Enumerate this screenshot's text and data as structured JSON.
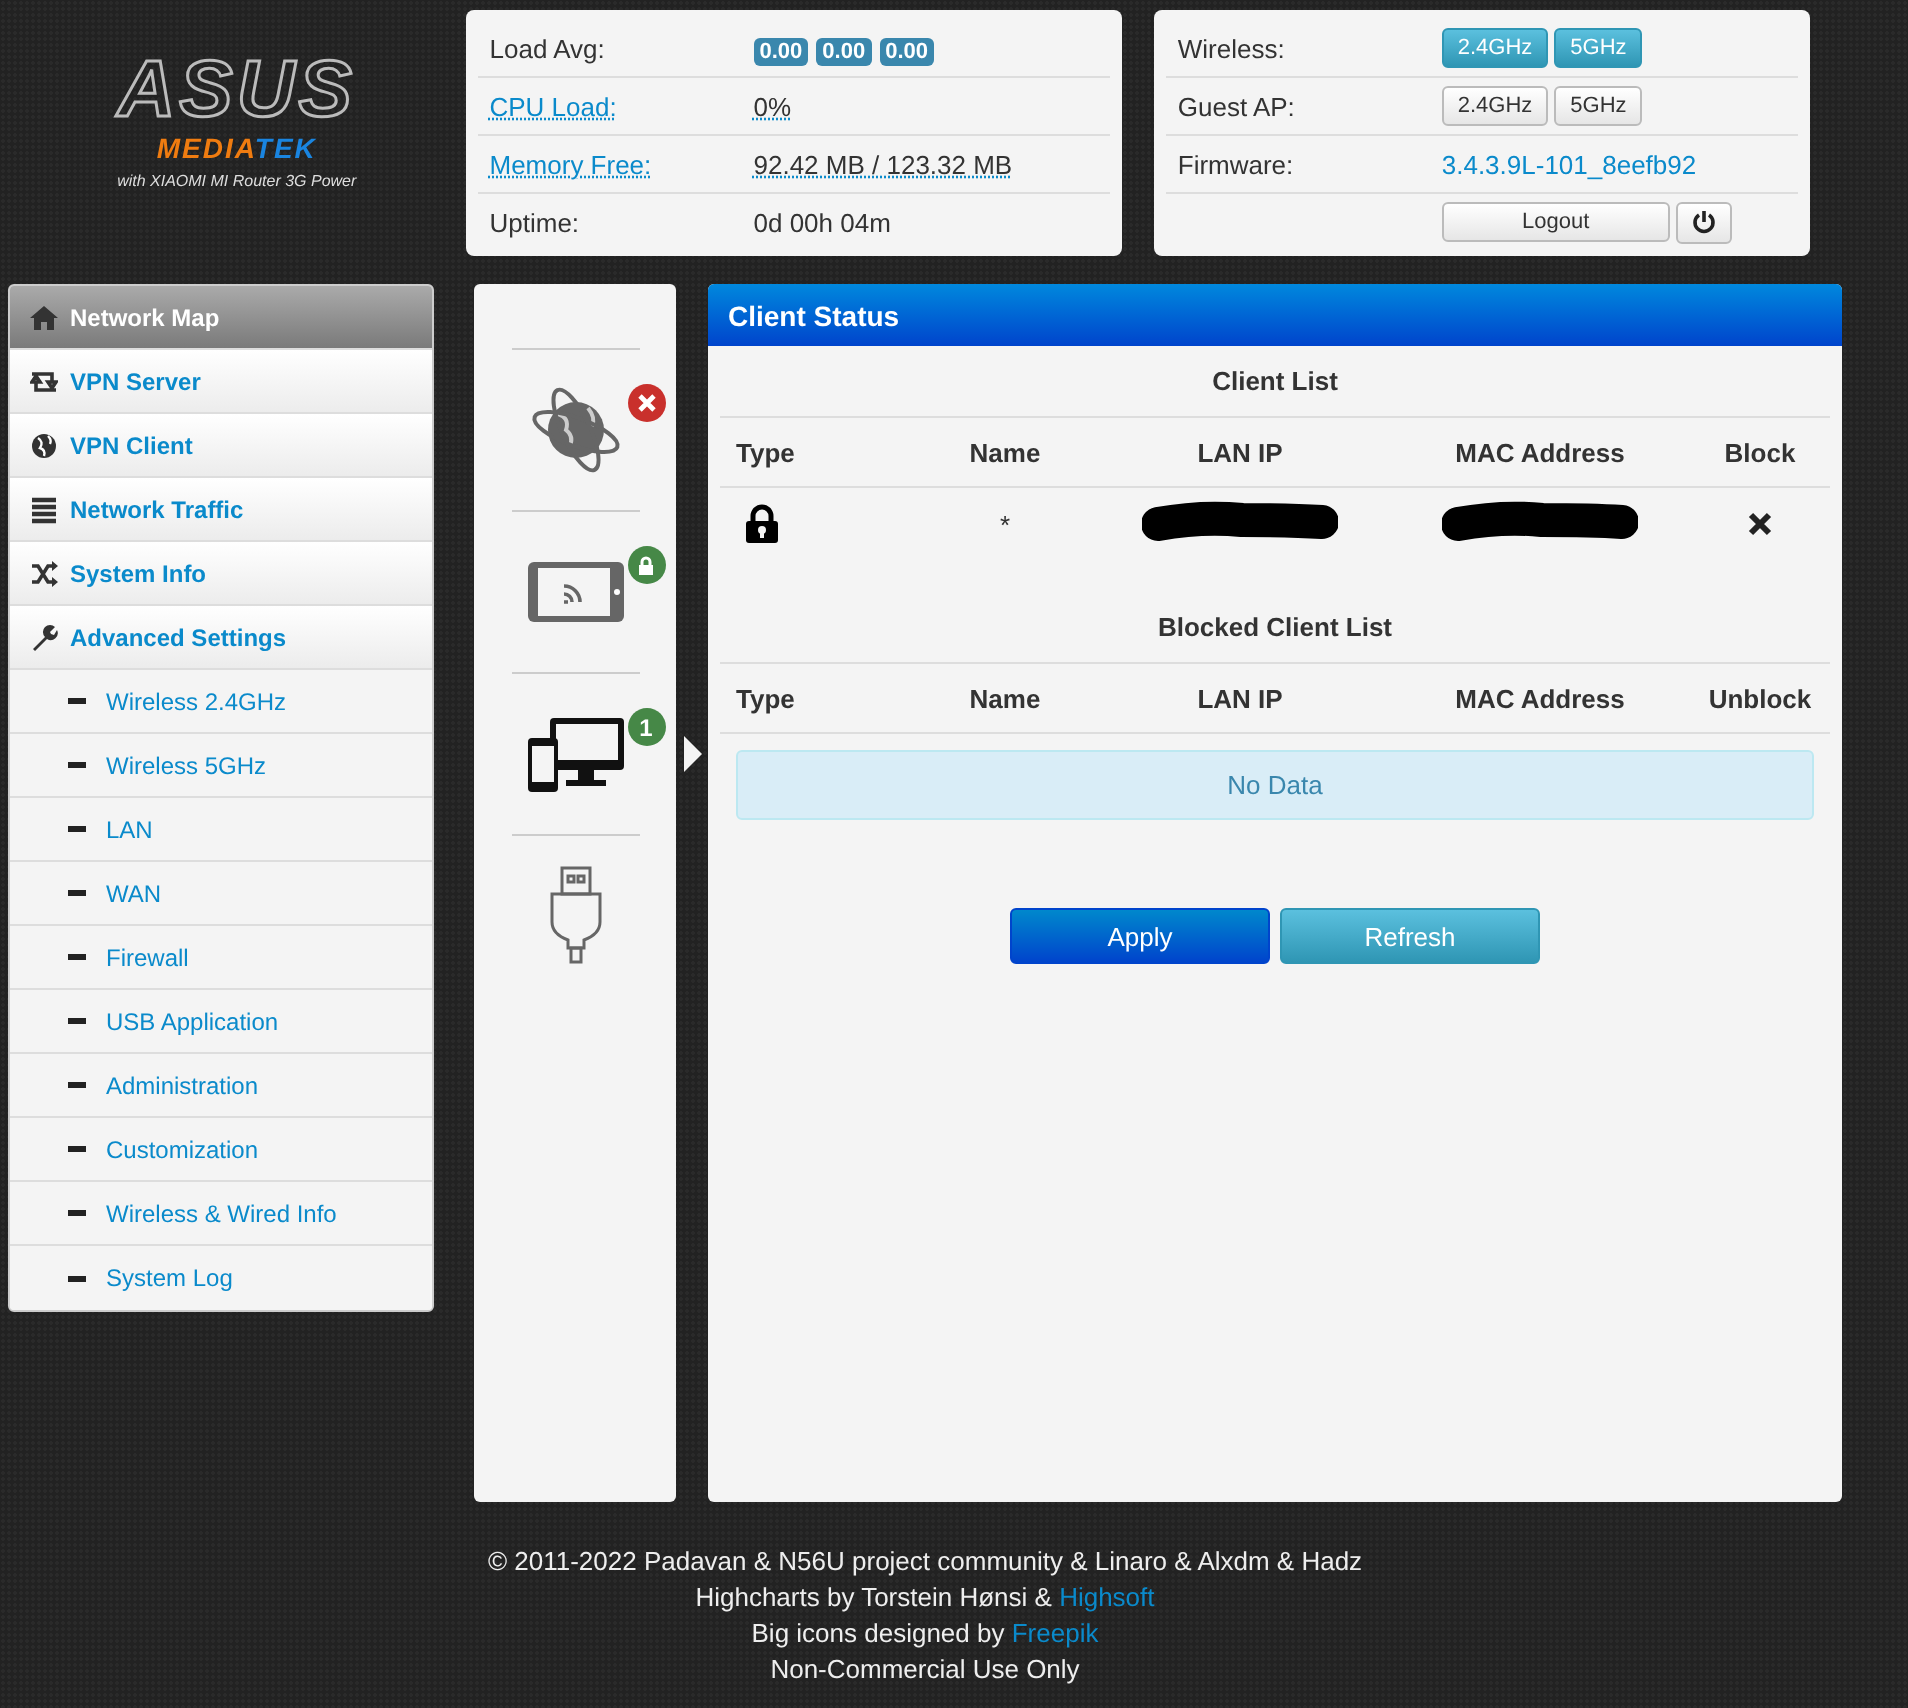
{
  "logo": {
    "brand": "ASUS",
    "maker": [
      "MEDIA",
      "TEK"
    ],
    "tagline": "with XIAOMI MI Router 3G Power"
  },
  "system_panel": {
    "rows": [
      {
        "kind": "badges",
        "label": "Load Avg:",
        "values": [
          "0.00",
          "0.00",
          "0.00"
        ]
      },
      {
        "kind": "link",
        "label": "CPU Load:",
        "value": "0%"
      },
      {
        "kind": "link",
        "label": "Memory Free:",
        "value": "92.42 MB / 123.32 MB"
      },
      {
        "kind": "plain",
        "label": "Uptime:",
        "value": "0d 00h 04m"
      }
    ]
  },
  "radio_panel": {
    "rows": [
      {
        "kind": "toggles",
        "label": "Wireless:",
        "buttons": [
          {
            "label": "2.4GHz",
            "on": true
          },
          {
            "label": "5GHz",
            "on": true
          }
        ]
      },
      {
        "kind": "toggles",
        "label": "Guest AP:",
        "buttons": [
          {
            "label": "2.4GHz",
            "on": false
          },
          {
            "label": "5GHz",
            "on": false
          }
        ]
      },
      {
        "kind": "firmware",
        "label": "Firmware:",
        "value": "3.4.3.9L-101_8eefb92"
      }
    ],
    "logout": "Logout"
  },
  "sidebar": {
    "items": [
      {
        "label": "Network Map",
        "selected": true
      },
      {
        "label": "VPN Server",
        "selected": false
      },
      {
        "label": "VPN Client",
        "selected": false
      },
      {
        "label": "Network Traffic",
        "selected": false
      },
      {
        "label": "System Info",
        "selected": false
      },
      {
        "label": "Advanced Settings",
        "selected": false,
        "children": [
          {
            "label": "Wireless 2.4GHz",
            "selected": false
          },
          {
            "label": "Wireless 5GHz",
            "selected": false
          },
          {
            "label": "LAN",
            "selected": false
          },
          {
            "label": "WAN",
            "selected": false
          },
          {
            "label": "Firewall",
            "selected": false
          },
          {
            "label": "USB Application",
            "selected": false
          },
          {
            "label": "Administration",
            "selected": false
          },
          {
            "label": "Customization",
            "selected": false
          },
          {
            "label": "Wireless & Wired Info",
            "selected": false
          },
          {
            "label": "System Log",
            "selected": false
          }
        ]
      }
    ]
  },
  "status_icons": [
    {
      "kind": "internet",
      "badge": {
        "kind": "error"
      },
      "selected": false
    },
    {
      "kind": "wireless",
      "badge": {
        "kind": "lock"
      },
      "selected": false
    },
    {
      "kind": "clients",
      "badge": {
        "kind": "count",
        "text": "1"
      },
      "selected": true
    },
    {
      "kind": "usb",
      "selected": false
    }
  ],
  "client_status": {
    "title": "Client Status",
    "client_list": {
      "title": "Client List",
      "columns": [
        "Type",
        "Name",
        "LAN IP",
        "MAC Address",
        "Block"
      ],
      "rows": [
        [
          {
            "kind": "lock"
          },
          {
            "kind": "text",
            "text": "*"
          },
          {
            "kind": "redacted"
          },
          {
            "kind": "redacted"
          },
          {
            "kind": "block"
          }
        ]
      ]
    },
    "blocked_list": {
      "title": "Blocked Client List",
      "columns": [
        "Type",
        "Name",
        "LAN IP",
        "MAC Address",
        "Unblock"
      ],
      "empty": "No Data"
    },
    "buttons": [
      {
        "label": "Apply",
        "kind": "primary"
      },
      {
        "label": "Refresh",
        "kind": "info"
      }
    ]
  },
  "footer": {
    "lines": [
      {
        "text": "© 2011-2022 Padavan & N56U project community & Linaro & Alxdm & Hadz"
      },
      {
        "text": "Highcharts by Torstein Hønsi & ",
        "link": "Highsoft"
      },
      {
        "text": "Big icons designed by ",
        "link": "Freepik"
      },
      {
        "text": "Non-Commercial Use Only"
      }
    ]
  }
}
